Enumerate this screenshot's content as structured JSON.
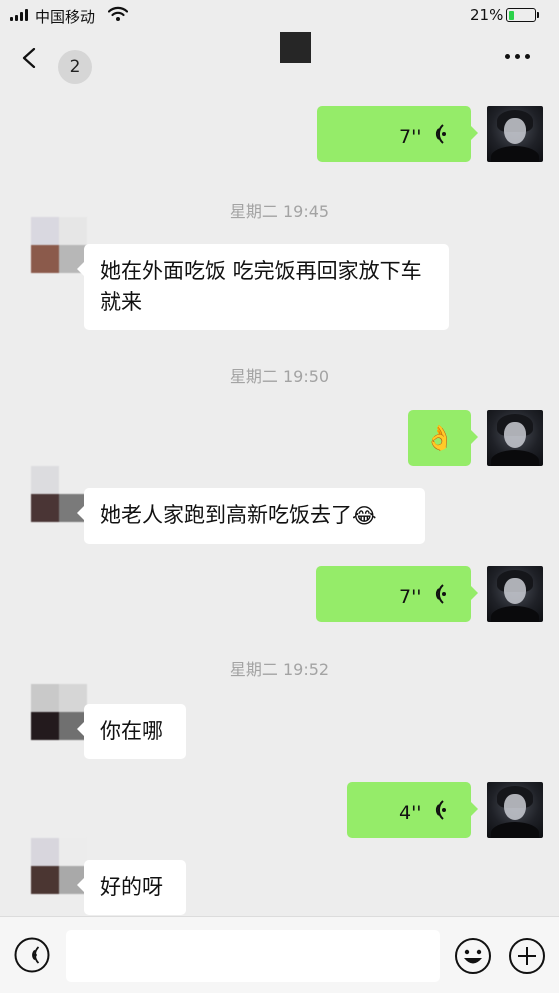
{
  "status_bar": {
    "carrier": "中国移动",
    "battery_percent": "21%",
    "battery_level": 0.21,
    "battery_color": "#2bd14a"
  },
  "nav": {
    "back_icon": "chevron-left-icon",
    "unread_count": "2",
    "more_icon": "more-horizontal-icon"
  },
  "messages": [
    {
      "type": "voice",
      "direction": "out",
      "duration": "7''"
    },
    {
      "type": "timestamp",
      "text": "星期二 19:45"
    },
    {
      "type": "text",
      "direction": "in",
      "text": "她在外面吃饭 吃完饭再回家放下车就来"
    },
    {
      "type": "timestamp",
      "text": "星期二 19:50"
    },
    {
      "type": "emoji",
      "direction": "out",
      "emoji": "👌"
    },
    {
      "type": "text",
      "direction": "in",
      "text": "她老人家跑到高新吃饭去了",
      "emoji": "😂"
    },
    {
      "type": "voice",
      "direction": "out",
      "duration": "7''"
    },
    {
      "type": "timestamp",
      "text": "星期二 19:52"
    },
    {
      "type": "text",
      "direction": "in",
      "text": "你在哪"
    },
    {
      "type": "voice",
      "direction": "out",
      "duration": "4''"
    },
    {
      "type": "text",
      "direction": "in",
      "text": "好的呀"
    }
  ],
  "input_bar": {
    "voice_icon": "voice-input-icon",
    "input_value": "",
    "emoji_icon": "smiley-icon",
    "plus_icon": "plus-circle-icon"
  },
  "colors": {
    "outgoing_bubble": "#95ec69",
    "incoming_bubble": "#ffffff",
    "background": "#ededed",
    "timestamp_text": "#a3a3a3"
  }
}
